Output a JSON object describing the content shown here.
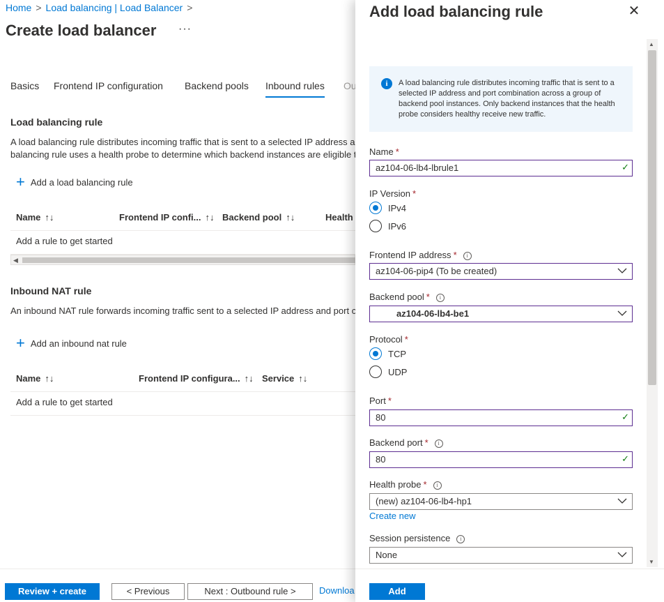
{
  "breadcrumb": [
    "Home",
    "Load balancing | Load Balancer"
  ],
  "page_title": "Create load balancer",
  "more_label": "···",
  "tabs": [
    {
      "label": "Basics"
    },
    {
      "label": "Frontend IP configuration"
    },
    {
      "label": "Backend pools"
    },
    {
      "label": "Inbound rules"
    },
    {
      "label": "Ou"
    }
  ],
  "lb_rule_section": {
    "title": "Load balancing rule",
    "desc_line1": "A load balancing rule distributes incoming traffic that is sent to a selected IP address and",
    "desc_line2": "balancing rule uses a health probe to determine which backend instances are eligible t",
    "add_label": "Add a load balancing rule",
    "columns": [
      "Name",
      "Frontend IP confi...",
      "Backend pool",
      "Health"
    ],
    "empty_row": "Add a rule to get started"
  },
  "nat_section": {
    "title": "Inbound NAT rule",
    "desc": "An inbound NAT rule forwards incoming traffic sent to a selected IP address and port c",
    "add_label": "Add an inbound nat rule",
    "columns": [
      "Name",
      "Frontend IP configura...",
      "Service"
    ],
    "empty_row": "Add a rule to get started"
  },
  "footer": {
    "review": "Review + create",
    "previous": "< Previous",
    "next": "Next : Outbound rule >",
    "download": "Downloa"
  },
  "panel": {
    "title": "Add load balancing rule",
    "info": "A load balancing rule distributes incoming traffic that is sent to a selected IP address and port combination across a group of backend pool instances. Only backend instances that the health probe considers healthy receive new traffic.",
    "name_label": "Name",
    "name_value": "az104-06-lb4-lbrule1",
    "ip_version_label": "IP Version",
    "ip_options": [
      "IPv4",
      "IPv6"
    ],
    "ip_selected": "IPv4",
    "frontend_label": "Frontend IP address",
    "frontend_value": "az104-06-pip4 (To be created)",
    "backend_pool_label": "Backend pool",
    "backend_pool_value": "az104-06-lb4-be1",
    "protocol_label": "Protocol",
    "protocol_options": [
      "TCP",
      "UDP"
    ],
    "protocol_selected": "TCP",
    "port_label": "Port",
    "port_value": "80",
    "backend_port_label": "Backend port",
    "backend_port_value": "80",
    "health_probe_label": "Health probe",
    "health_probe_value": "(new) az104-06-lb4-hp1",
    "create_new": "Create new",
    "session_label": "Session persistence",
    "session_value": "None",
    "add_button": "Add"
  },
  "colors": {
    "accent": "#0078d4",
    "required": "#a4262c",
    "valid": "#107c10",
    "focus_border": "#5c2d91"
  }
}
